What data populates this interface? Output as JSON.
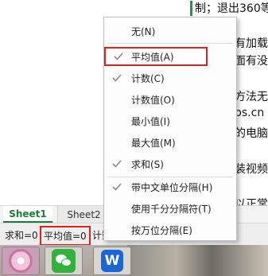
{
  "document": {
    "lines": [
      "制；退出360等",
      "有加载",
      "面有没",
      "方法无",
      "ps.cn",
      "的电脑",
      "装视频",
      "以正常"
    ]
  },
  "sheet_tabs": {
    "active": "Sheet1",
    "second": "Sheet2"
  },
  "status_bar": {
    "sum": "求和=0",
    "average": "平均值=0",
    "count_partial": "计数"
  },
  "context_menu": {
    "items": [
      {
        "label": "无(N)",
        "checked": false
      },
      {
        "label": "平均值(A)",
        "checked": true,
        "highlighted": true
      },
      {
        "label": "计数(C)",
        "checked": true
      },
      {
        "label": "计数值(O)",
        "checked": false
      },
      {
        "label": "最小值(I)",
        "checked": false
      },
      {
        "label": "最大值(M)",
        "checked": false
      },
      {
        "label": "求和(S)",
        "checked": true
      },
      {
        "label": "带中文单位分隔(H)",
        "checked": true
      },
      {
        "label": "使用千分分隔符(T)",
        "checked": false
      },
      {
        "label": "按万位分隔(E)",
        "checked": false
      }
    ]
  },
  "taskbar": {
    "apps": [
      "flower-app-icon",
      "wechat-icon",
      "wps-icon"
    ],
    "wps_glyph": "W"
  },
  "colors": {
    "highlight_border": "#e02020",
    "check_color": "#8a8a8a",
    "sheet_active": "#1a7f37"
  }
}
